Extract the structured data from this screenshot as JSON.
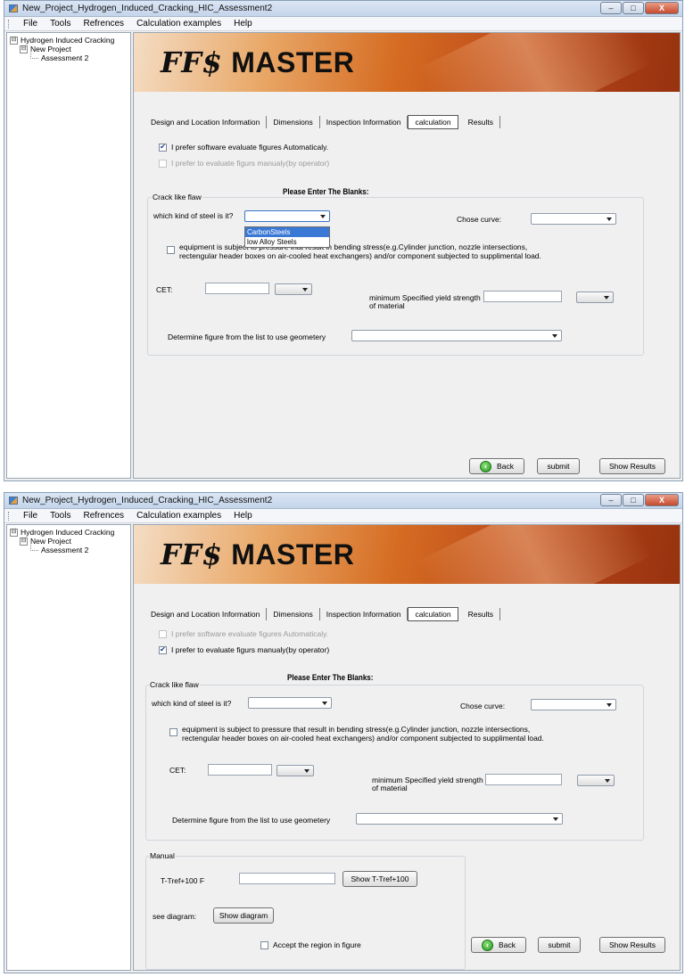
{
  "windows": [
    {
      "title": "New_Project_Hydrogen_Induced_Cracking_HIC_Assessment2",
      "window_controls": {
        "close": "X"
      },
      "menu": [
        "File",
        "Tools",
        "Refrences",
        "Calculation examples",
        "Help"
      ],
      "tree": {
        "root": "Hydrogen Induced Cracking",
        "project": "New Project",
        "assessment": "Assessment 2",
        "expand_glyph": "⊟"
      },
      "banner": {
        "logo_ffs": "FF$",
        "logo_master": "MASTER"
      },
      "tabs": [
        "Design and Location Information",
        "Dimensions",
        "Inspection Information",
        "calculation",
        "Results"
      ],
      "active_tab": "calculation",
      "options": {
        "auto_label": "I prefer software evaluate figures Automaticaly.",
        "auto_checked": true,
        "manual_label": "I prefer to evaluate figurs manualy(by operator)",
        "manual_checked": false,
        "auto_enabled": true,
        "manual_enabled": false
      },
      "form": {
        "heading": "Please Enter The Blanks:",
        "group_label": "Crack like flaw",
        "steel_label": "which kind of steel is it?",
        "steel_value": "",
        "steel_options": [
          "CarbonSteels",
          "low Alloy Steels"
        ],
        "steel_highlighted": "CarbonSteels",
        "curve_label": "Chose curve:",
        "curve_value": "",
        "bending_text_line1": "equipment is subject to pressure that result in bending stress(e.g.Cylinder junction, nozzle intersections,",
        "bending_text_line2": "rectengular header boxes on air-cooled heat exchangers) and/or component subjected to supplimental load.",
        "bending_checked": false,
        "cet_label": "CET:",
        "cet_value": "",
        "cet_unit": "",
        "yield_label_line1": "minimum Specified yield strength",
        "yield_label_line2": "of material",
        "yield_value": "",
        "yield_unit": "",
        "geometry_label": "Determine figure from the list to use geometery",
        "geometry_value": ""
      },
      "buttons": {
        "back": "Back",
        "submit": "submit",
        "show_results": "Show Results"
      }
    },
    {
      "title": "New_Project_Hydrogen_Induced_Cracking_HIC_Assessment2",
      "window_controls": {
        "close": "X"
      },
      "menu": [
        "File",
        "Tools",
        "Refrences",
        "Calculation examples",
        "Help"
      ],
      "tree": {
        "root": "Hydrogen Induced Cracking",
        "project": "New Project",
        "assessment": "Assessment 2",
        "expand_glyph": "⊟"
      },
      "banner": {
        "logo_ffs": "FF$",
        "logo_master": "MASTER"
      },
      "tabs": [
        "Design and Location Information",
        "Dimensions",
        "Inspection Information",
        "calculation",
        "Results"
      ],
      "active_tab": "calculation",
      "options": {
        "auto_label": "I prefer software evaluate figures Automaticaly.",
        "auto_checked": false,
        "manual_label": "I prefer to evaluate figurs manualy(by operator)",
        "manual_checked": true,
        "auto_enabled": false,
        "manual_enabled": true
      },
      "form": {
        "heading": "Please Enter The Blanks:",
        "group_label": "Crack like flaw",
        "steel_label": "which kind of steel is it?",
        "steel_value": "",
        "curve_label": "Chose curve:",
        "curve_value": "",
        "bending_text_line1": "equipment is subject to pressure that result in bending stress(e.g.Cylinder junction, nozzle intersections,",
        "bending_text_line2": "rectengular header boxes on air-cooled heat exchangers) and/or component subjected to supplimental load.",
        "bending_checked": false,
        "cet_label": "CET:",
        "cet_value": "",
        "cet_unit": "",
        "yield_label_line1": "minimum Specified yield strength",
        "yield_label_line2": "of material",
        "yield_value": "",
        "yield_unit": "",
        "geometry_label": "Determine figure from the list to use geometery",
        "geometry_value": ""
      },
      "manual": {
        "group_label": "Manual",
        "tref_label": "T-Tref+100 F",
        "tref_value": "",
        "show_tref_button": "Show T-Tref+100",
        "see_diagram_label": "see diagram:",
        "show_diagram_button": "Show diagram",
        "accept_label": "Accept the region in figure",
        "accept_checked": false
      },
      "buttons": {
        "back": "Back",
        "submit": "submit",
        "show_results": "Show Results"
      }
    }
  ],
  "colors": {
    "check": "#1a3f8a",
    "highlight": "#3a78d6",
    "banner_dark": "#97320f",
    "banner_light": "#f4ddc4"
  }
}
